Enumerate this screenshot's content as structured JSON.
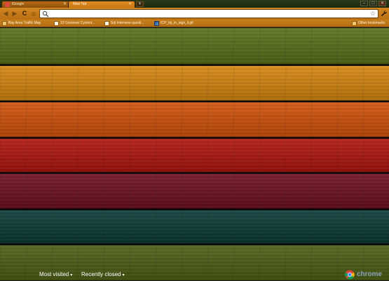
{
  "tabs": [
    {
      "title": "iGoogle",
      "active": false,
      "favicon_color": "#d94b3a"
    },
    {
      "title": "New Tab",
      "active": true,
      "favicon_color": ""
    }
  ],
  "new_tab_symbol": "+",
  "window_controls": [
    "–",
    "□",
    "✕"
  ],
  "toolbar": {
    "back": "◀",
    "forward": "▶",
    "reload": "C",
    "home": "⌂",
    "address_value": "",
    "star": "☆",
    "wrench": "🔧"
  },
  "bookmarks": [
    {
      "label": "Bay Area Traffic Map",
      "icon": "folder"
    },
    {
      "label": "10 Common Cycloni...",
      "icon": "page"
    },
    {
      "label": "Sql Interview questi...",
      "icon": "page"
    },
    {
      "label": "ICP_tip_in_sign_ll.gif",
      "icon": "picture"
    }
  ],
  "other_bookmarks": "Other bookmarks",
  "theme_stripes": [
    {
      "name": "green",
      "color": "#5a6f1a"
    },
    {
      "name": "orange",
      "color": "#d6860f"
    },
    {
      "name": "dark-orange",
      "color": "#d2520a"
    },
    {
      "name": "red",
      "color": "#b0140f"
    },
    {
      "name": "crimson",
      "color": "#6e0f22"
    },
    {
      "name": "teal",
      "color": "#0b3a34"
    },
    {
      "name": "olive",
      "color": "#4d5e14"
    }
  ],
  "footer": {
    "most_visited": "Most visited",
    "recently_closed": "Recently closed",
    "dropdown_arrow": "▾",
    "brand": "chrome"
  }
}
